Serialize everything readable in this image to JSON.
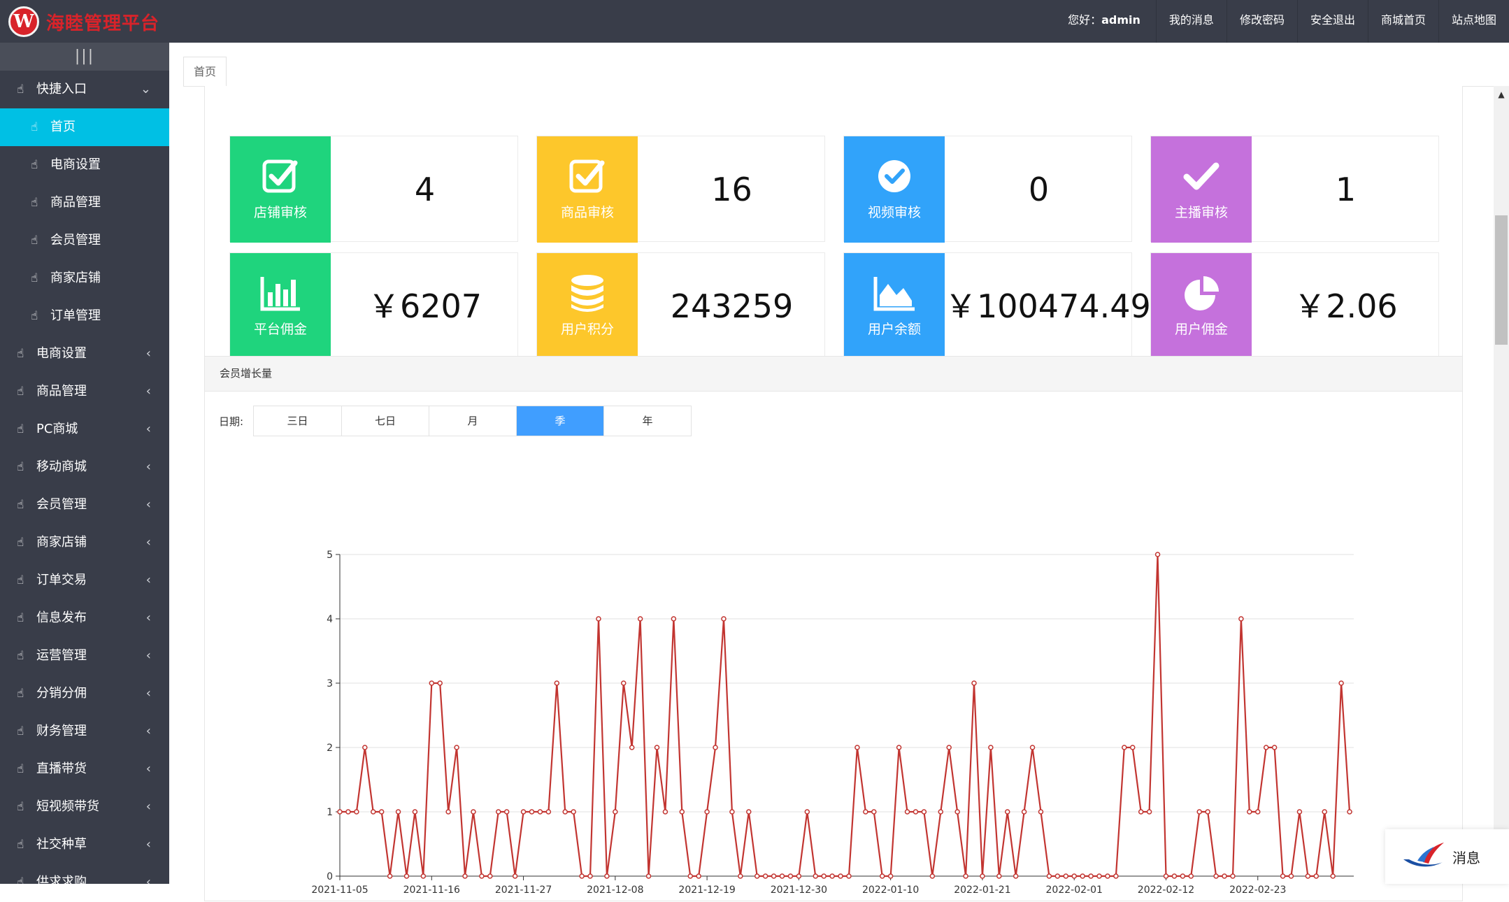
{
  "header": {
    "brand": "海睦管理平台",
    "logo_letter": "W",
    "greeting_prefix": "您好：",
    "username": "admin",
    "links": [
      "我的消息",
      "修改密码",
      "安全退出",
      "商城首页",
      "站点地图"
    ]
  },
  "sidebar": {
    "toggle_icon": "|||",
    "items": [
      {
        "label": "快捷入口",
        "type": "group-open"
      },
      {
        "label": "首页",
        "type": "sub",
        "active": true
      },
      {
        "label": "电商设置",
        "type": "sub"
      },
      {
        "label": "商品管理",
        "type": "sub"
      },
      {
        "label": "会员管理",
        "type": "sub"
      },
      {
        "label": "商家店铺",
        "type": "sub"
      },
      {
        "label": "订单管理",
        "type": "sub"
      },
      {
        "label": "电商设置",
        "type": "group"
      },
      {
        "label": "商品管理",
        "type": "group"
      },
      {
        "label": "PC商城",
        "type": "group"
      },
      {
        "label": "移动商城",
        "type": "group"
      },
      {
        "label": "会员管理",
        "type": "group"
      },
      {
        "label": "商家店铺",
        "type": "group"
      },
      {
        "label": "订单交易",
        "type": "group"
      },
      {
        "label": "信息发布",
        "type": "group"
      },
      {
        "label": "运营管理",
        "type": "group"
      },
      {
        "label": "分销分佣",
        "type": "group"
      },
      {
        "label": "财务管理",
        "type": "group"
      },
      {
        "label": "直播带货",
        "type": "group"
      },
      {
        "label": "短视频带货",
        "type": "group"
      },
      {
        "label": "社交种草",
        "type": "group"
      },
      {
        "label": "供求求购",
        "type": "group"
      }
    ]
  },
  "tabs": {
    "home": "首页"
  },
  "cards": [
    {
      "label": "店铺审核",
      "value": "4",
      "color": "#1fd47d",
      "icon": "check-square-icon"
    },
    {
      "label": "商品审核",
      "value": "16",
      "color": "#fdc72b",
      "icon": "check-square-icon"
    },
    {
      "label": "视频审核",
      "value": "0",
      "color": "#31a3fa",
      "icon": "check-circle-icon"
    },
    {
      "label": "主播审核",
      "value": "1",
      "color": "#c571dc",
      "icon": "check-icon"
    },
    {
      "label": "平台佣金",
      "value": "￥6207",
      "color": "#1fd47d",
      "icon": "bar-chart-icon"
    },
    {
      "label": "用户积分",
      "value": "243259",
      "color": "#fdc72b",
      "icon": "database-icon"
    },
    {
      "label": "用户余额",
      "value": "￥100474.49",
      "color": "#31a3fa",
      "icon": "area-chart-icon"
    },
    {
      "label": "用户佣金",
      "value": "￥2.06",
      "color": "#c571dc",
      "icon": "pie-chart-icon"
    }
  ],
  "chart_panel": {
    "title": "会员增长量",
    "date_label": "日期:",
    "ranges": [
      "三日",
      "七日",
      "月",
      "季",
      "年"
    ],
    "selected": "季"
  },
  "chart_data": {
    "type": "line",
    "x_start": "2021-11-05",
    "tick_labels": [
      "2021-11-05",
      "2021-11-16",
      "2021-11-27",
      "2021-12-08",
      "2021-12-19",
      "2021-12-30",
      "2022-01-10",
      "2022-01-21",
      "2022-02-01",
      "2022-02-12",
      "2022-02-23"
    ],
    "ylim": [
      0,
      5
    ],
    "yticks": [
      0,
      1,
      2,
      3,
      4,
      5
    ],
    "line_color": "#c23531",
    "values": [
      1,
      1,
      1,
      2,
      1,
      1,
      0,
      1,
      0,
      1,
      0,
      3,
      3,
      1,
      2,
      0,
      1,
      0,
      0,
      1,
      1,
      0,
      1,
      1,
      1,
      1,
      3,
      1,
      1,
      0,
      0,
      4,
      0,
      1,
      3,
      2,
      4,
      0,
      2,
      1,
      4,
      1,
      0,
      0,
      1,
      2,
      4,
      1,
      0,
      1,
      0,
      0,
      0,
      0,
      0,
      0,
      1,
      0,
      0,
      0,
      0,
      0,
      2,
      1,
      1,
      0,
      0,
      2,
      1,
      1,
      1,
      0,
      1,
      2,
      1,
      0,
      3,
      0,
      2,
      0,
      1,
      0,
      1,
      2,
      1,
      0,
      0,
      0,
      0,
      0,
      0,
      0,
      0,
      0,
      2,
      2,
      1,
      1,
      5,
      0,
      0,
      0,
      0,
      1,
      1,
      0,
      0,
      0,
      4,
      1,
      1,
      2,
      2,
      0,
      0,
      1,
      0,
      0,
      1,
      0,
      3,
      1
    ]
  },
  "message_box": {
    "label": "消息"
  }
}
